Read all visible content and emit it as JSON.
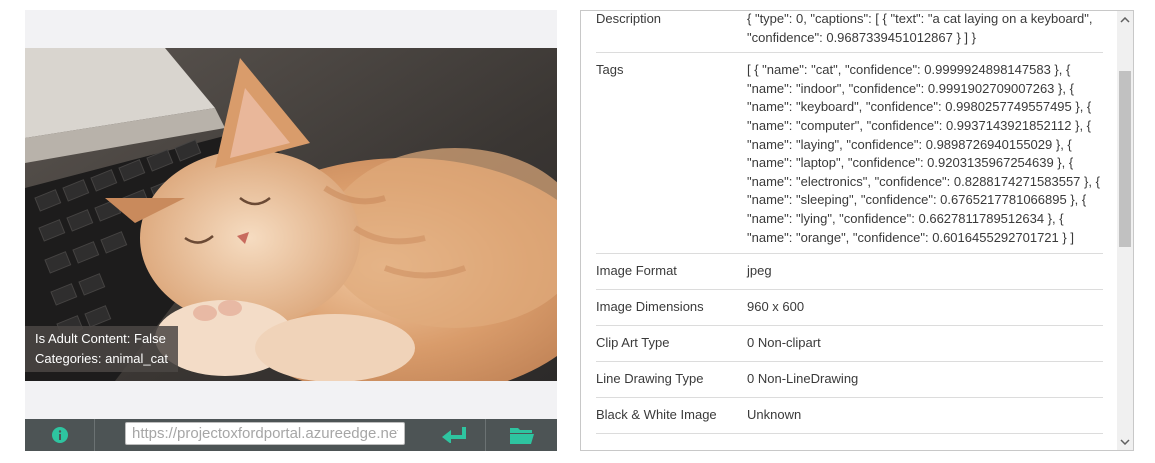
{
  "image_overlay": {
    "adult": "Is Adult Content: False",
    "categories": "Categories: animal_cat"
  },
  "toolbar": {
    "url_placeholder": "https://projectoxfordportal.azureedge.net",
    "icons": [
      "info-icon",
      "enter-icon",
      "folder-icon"
    ],
    "accent_color": "#2ec4a0"
  },
  "results": [
    {
      "key": "Description",
      "value": "{ \"type\": 0, \"captions\": [ { \"text\": \"a cat laying on a keyboard\", \"confidence\": 0.9687339451012867 } ] }"
    },
    {
      "key": "Tags",
      "value": "[ { \"name\": \"cat\", \"confidence\": 0.9999924898147583 }, { \"name\": \"indoor\", \"confidence\": 0.9991902709007263 }, { \"name\": \"keyboard\", \"confidence\": 0.9980257749557495 }, { \"name\": \"computer\", \"confidence\": 0.9937143921852112 }, { \"name\": \"laying\", \"confidence\": 0.9898726940155029 }, { \"name\": \"laptop\", \"confidence\": 0.9203135967254639 }, { \"name\": \"electronics\", \"confidence\": 0.8288174271583557 }, { \"name\": \"sleeping\", \"confidence\": 0.6765217781066895 }, { \"name\": \"lying\", \"confidence\": 0.6627811789512634 }, { \"name\": \"orange\", \"confidence\": 0.6016455292701721 } ]"
    },
    {
      "key": "Image Format",
      "value": "jpeg"
    },
    {
      "key": "Image Dimensions",
      "value": "960 x 600"
    },
    {
      "key": "Clip Art Type",
      "value": "0 Non-clipart"
    },
    {
      "key": "Line Drawing Type",
      "value": "0 Non-LineDrawing"
    },
    {
      "key": "Black & White Image",
      "value": "Unknown"
    }
  ]
}
